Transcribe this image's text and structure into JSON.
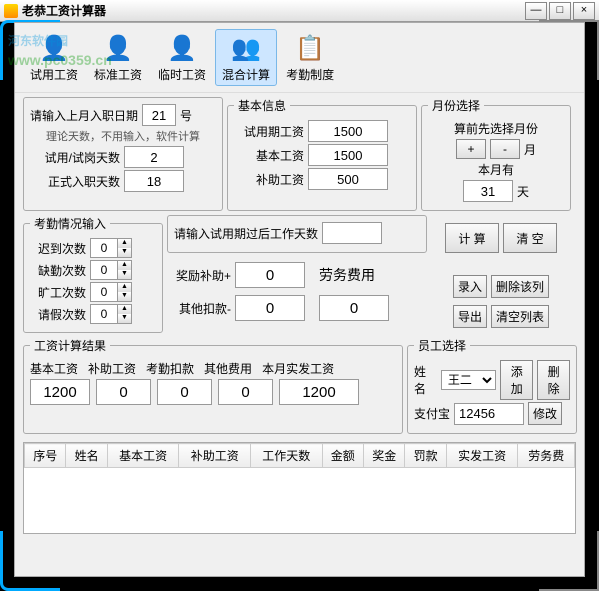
{
  "window": {
    "title": "老恭工资计算器"
  },
  "watermark": {
    "text": "河东软件园",
    "url": "www.pc0359.cn"
  },
  "toolbar": {
    "items": [
      {
        "label": "试用工资",
        "icon": "👤",
        "color": "#6c6"
      },
      {
        "label": "标准工资",
        "icon": "👤",
        "color": "#6c6"
      },
      {
        "label": "临时工资",
        "icon": "👤",
        "color": "#6c6"
      },
      {
        "label": "混合计算",
        "icon": "👥",
        "color": "#3a9"
      },
      {
        "label": "考勤制度",
        "icon": "📋",
        "color": "#c96"
      }
    ],
    "active_index": 3
  },
  "entry_date": {
    "prompt": "请输入上月入职日期",
    "value": "21",
    "suffix": "号",
    "note": "理论天数，不用输入，软件计算"
  },
  "trial_days": {
    "label": "试用/试岗天数",
    "value": "2"
  },
  "formal_days": {
    "label": "正式入职天数",
    "value": "18"
  },
  "basic_info": {
    "legend": "基本信息",
    "trial_salary": {
      "label": "试用期工资",
      "value": "1500"
    },
    "base_salary": {
      "label": "基本工资",
      "value": "1500"
    },
    "subsidy": {
      "label": "补助工资",
      "value": "500"
    }
  },
  "month_select": {
    "legend": "月份选择",
    "note": "算前先选择月份",
    "plus": "+",
    "minus": "-",
    "month_suffix": "月",
    "has_label": "本月有",
    "days": "31",
    "day_suffix": "天"
  },
  "attendance": {
    "legend": "考勤情况输入",
    "late": {
      "label": "迟到次数",
      "value": "0"
    },
    "absent": {
      "label": "缺勤次数",
      "value": "0"
    },
    "skip": {
      "label": "旷工次数",
      "value": "0"
    },
    "leave": {
      "label": "请假次数",
      "value": "0"
    }
  },
  "after_trial": {
    "prompt": "请输入试用期过后工作天数",
    "value": ""
  },
  "bonus": {
    "label": "奖励补助+",
    "value": "0"
  },
  "deduct": {
    "label": "其他扣款-",
    "value": "0"
  },
  "labor_fee": {
    "label": "劳务费用",
    "value": "0"
  },
  "actions": {
    "calc": "计 算",
    "clear": "清 空",
    "record": "录入",
    "del_row": "删除该列",
    "export": "导出",
    "clear_list": "清空列表"
  },
  "result": {
    "legend": "工资计算结果",
    "headers": {
      "base": "基本工资",
      "subsidy": "补助工资",
      "att_deduct": "考勤扣款",
      "other": "其他费用",
      "actual": "本月实发工资"
    },
    "values": {
      "base": "1200",
      "subsidy": "0",
      "att_deduct": "0",
      "other": "0",
      "actual": "1200"
    }
  },
  "employee": {
    "legend": "员工选择",
    "name_label": "姓名",
    "name_value": "王二",
    "add": "添加",
    "delete": "删除",
    "alipay_label": "支付宝",
    "alipay_value": "12456",
    "modify": "修改"
  },
  "table": {
    "cols": [
      "序号",
      "姓名",
      "基本工资",
      "补助工资",
      "工作天数",
      "金额",
      "奖金",
      "罚款",
      "实发工资",
      "劳务费"
    ]
  }
}
